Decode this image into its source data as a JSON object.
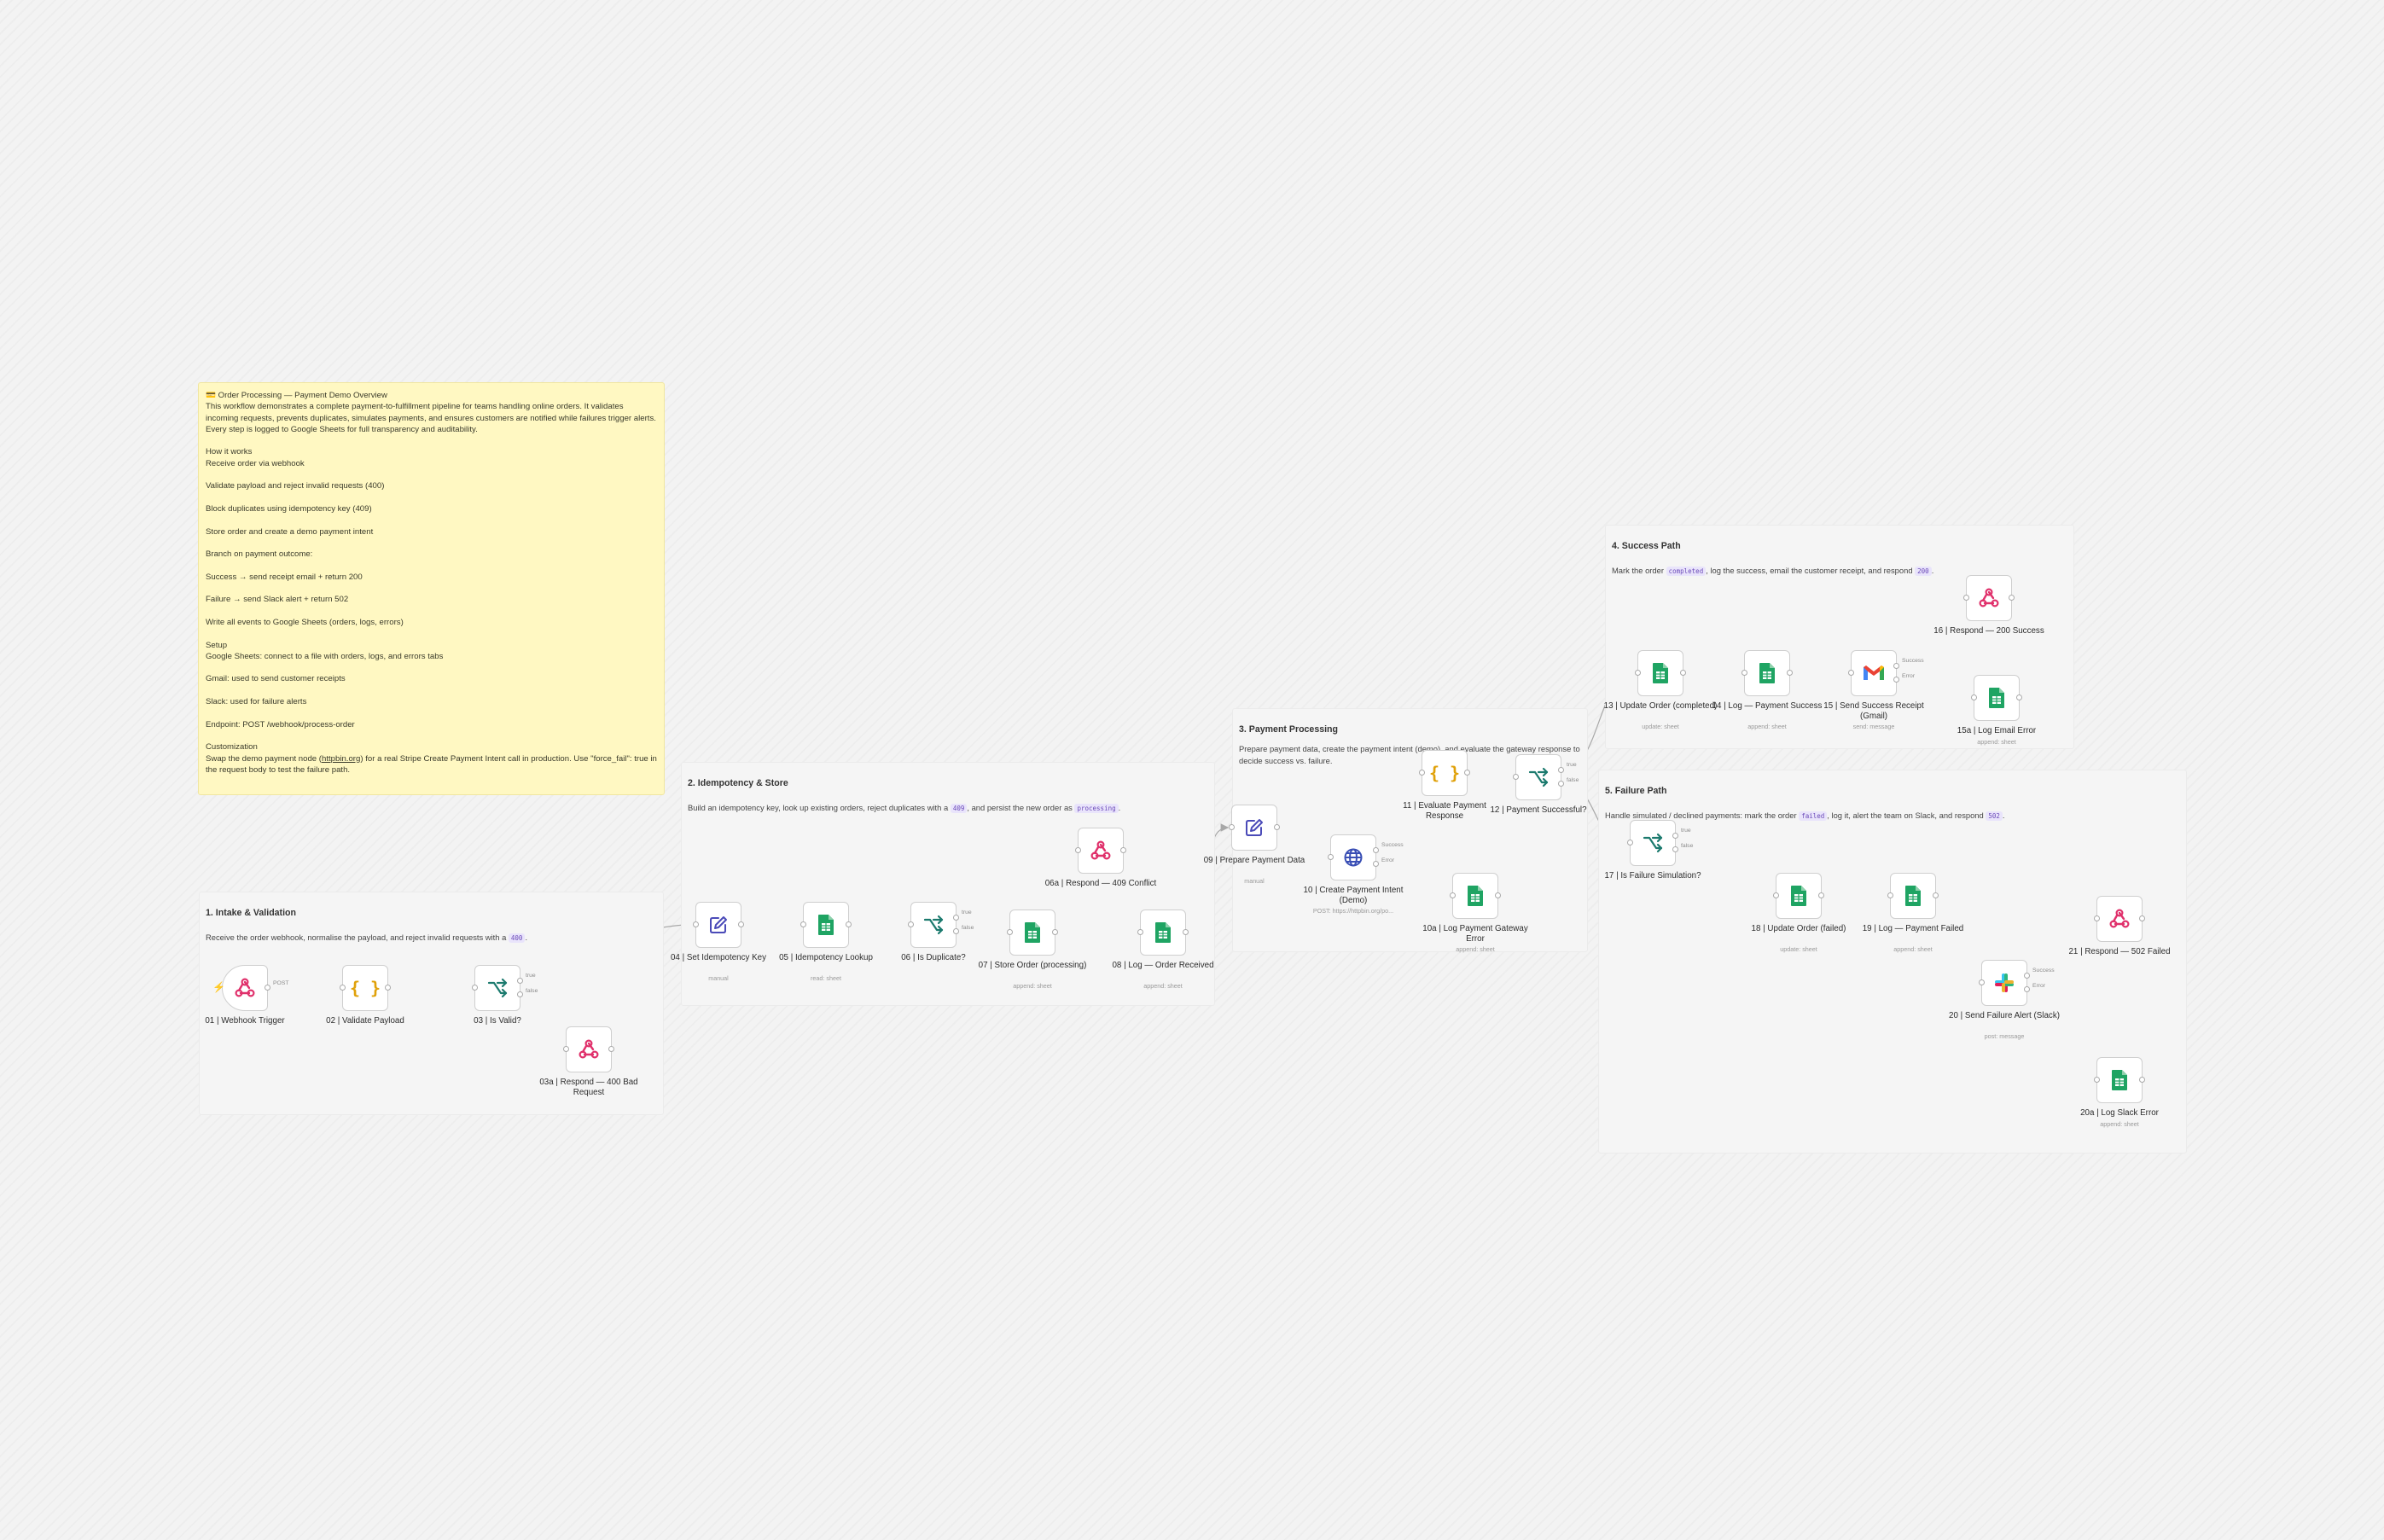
{
  "overview_note": {
    "title": "💳 Order Processing — Payment Demo Overview",
    "intro": "This workflow demonstrates a complete payment-to-fulfillment pipeline for teams handling online orders. It validates incoming requests, prevents duplicates, simulates payments, and ensures customers are notified while failures trigger alerts. Every step is logged to Google Sheets for full transparency and auditability.",
    "paragraphs": [
      "How it works\nReceive order via webhook",
      "Validate payload and reject invalid requests (400)",
      "Block duplicates using idempotency key (409)",
      "Store order and create a demo payment intent",
      "Branch on payment outcome:",
      "Success → send receipt email + return 200",
      "Failure → send Slack alert + return 502",
      "Write all events to Google Sheets (orders, logs, errors)",
      "Setup\nGoogle Sheets: connect to a file with orders, logs, and errors tabs",
      "Gmail: used to send customer receipts",
      "Slack: used for failure alerts",
      "Endpoint: POST /webhook/process-order"
    ],
    "customization_title": "Customization",
    "customization_pre": "Swap the demo payment node (",
    "customization_link": "httpbin.org",
    "customization_post": ") for a real Stripe Create Payment Intent call in production. Use \"force_fail\": true in the request body to test the failure path."
  },
  "sections": {
    "s1": {
      "title": "1. Intake & Validation",
      "desc_pre": "Receive the order webhook, normalise the payload, and reject invalid requests with a ",
      "code": "400",
      "desc_post": "."
    },
    "s2": {
      "title": "2. Idempotency & Store",
      "desc_pre": "Build an idempotency key, look up existing orders, reject duplicates with a ",
      "code": "409",
      "desc_mid": ", and persist the new order as ",
      "code2": "processing",
      "desc_post": "."
    },
    "s3": {
      "title": "3. Payment Processing",
      "desc": "Prepare payment data, create the payment intent (demo), and evaluate the gateway response to decide success vs. failure."
    },
    "s4": {
      "title": "4. Success Path",
      "desc_pre": "Mark the order ",
      "code": "completed",
      "desc_mid": ", log the success, email the customer receipt, and respond ",
      "code2": "200",
      "desc_post": "."
    },
    "s5": {
      "title": "5. Failure Path",
      "desc_pre": "Handle simulated / declined payments: mark the order ",
      "code": "failed",
      "desc_mid": ", log it, alert the team on Slack, and respond ",
      "code2": "502",
      "desc_post": "."
    }
  },
  "nodes": {
    "n01": {
      "label": "01 | Webhook Trigger",
      "sub": "",
      "icon": "webhook-icon"
    },
    "n02": {
      "label": "02 | Validate Payload",
      "sub": "",
      "icon": "code-braces-icon"
    },
    "n03": {
      "label": "03 | Is Valid?",
      "sub": "",
      "icon": "if-branch-icon"
    },
    "n03a": {
      "label": "03a | Respond — 400 Bad Request",
      "sub": "",
      "icon": "webhook-icon"
    },
    "n04": {
      "label": "04 | Set Idempotency Key",
      "sub": "manual",
      "icon": "edit-pen-icon"
    },
    "n05": {
      "label": "05 | Idempotency Lookup",
      "sub": "read: sheet",
      "icon": "google-sheets-icon"
    },
    "n06": {
      "label": "06 | Is Duplicate?",
      "sub": "",
      "icon": "if-branch-icon"
    },
    "n06a": {
      "label": "06a | Respond — 409 Conflict",
      "sub": "",
      "icon": "webhook-icon"
    },
    "n07": {
      "label": "07 | Store Order (processing)",
      "sub": "append: sheet",
      "icon": "google-sheets-icon"
    },
    "n08": {
      "label": "08 | Log — Order Received",
      "sub": "append: sheet",
      "icon": "google-sheets-icon"
    },
    "n09": {
      "label": "09 | Prepare Payment Data",
      "sub": "manual",
      "icon": "edit-pen-icon"
    },
    "n10": {
      "label": "10 | Create Payment Intent (Demo)",
      "sub": "POST: https://httpbin.org/po...",
      "icon": "globe-icon"
    },
    "n10a": {
      "label": "10a | Log Payment Gateway Error",
      "sub": "append: sheet",
      "icon": "google-sheets-icon"
    },
    "n11": {
      "label": "11 | Evaluate Payment Response",
      "sub": "",
      "icon": "code-braces-icon"
    },
    "n12": {
      "label": "12 | Payment Successful?",
      "sub": "",
      "icon": "if-branch-icon"
    },
    "n13": {
      "label": "13 | Update Order (completed)",
      "sub": "update: sheet",
      "icon": "google-sheets-icon"
    },
    "n14": {
      "label": "14 | Log — Payment Success",
      "sub": "append: sheet",
      "icon": "google-sheets-icon"
    },
    "n15": {
      "label": "15 | Send Success Receipt (Gmail)",
      "sub": "send: message",
      "icon": "gmail-icon"
    },
    "n15a": {
      "label": "15a | Log Email Error",
      "sub": "append: sheet",
      "icon": "google-sheets-icon"
    },
    "n16": {
      "label": "16 | Respond — 200 Success",
      "sub": "",
      "icon": "webhook-icon"
    },
    "n17": {
      "label": "17 | Is Failure Simulation?",
      "sub": "",
      "icon": "if-branch-icon"
    },
    "n18": {
      "label": "18 | Update Order (failed)",
      "sub": "update: sheet",
      "icon": "google-sheets-icon"
    },
    "n19": {
      "label": "19 | Log — Payment Failed",
      "sub": "append: sheet",
      "icon": "google-sheets-icon"
    },
    "n20": {
      "label": "20 | Send Failure Alert (Slack)",
      "sub": "post: message",
      "icon": "slack-icon"
    },
    "n20a": {
      "label": "20a | Log Slack Error",
      "sub": "append: sheet",
      "icon": "google-sheets-icon"
    },
    "n21": {
      "label": "21 | Respond — 502 Failed",
      "sub": "",
      "icon": "webhook-icon"
    }
  },
  "port_labels": {
    "post": "POST",
    "true": "true",
    "false": "false",
    "success": "Success",
    "error": "Error"
  },
  "colors": {
    "canvas": "#f3f3f3",
    "note": "#fff8c2",
    "section": "#f5f5f5",
    "edge": "#a8a8a8",
    "webhook": "#e0306b",
    "sheets": "#1fa463",
    "branch": "#1b7a6e",
    "braces": "#e0a10a",
    "pen": "#4a4ab8",
    "trigger_bolt": "#ff6d3a"
  }
}
